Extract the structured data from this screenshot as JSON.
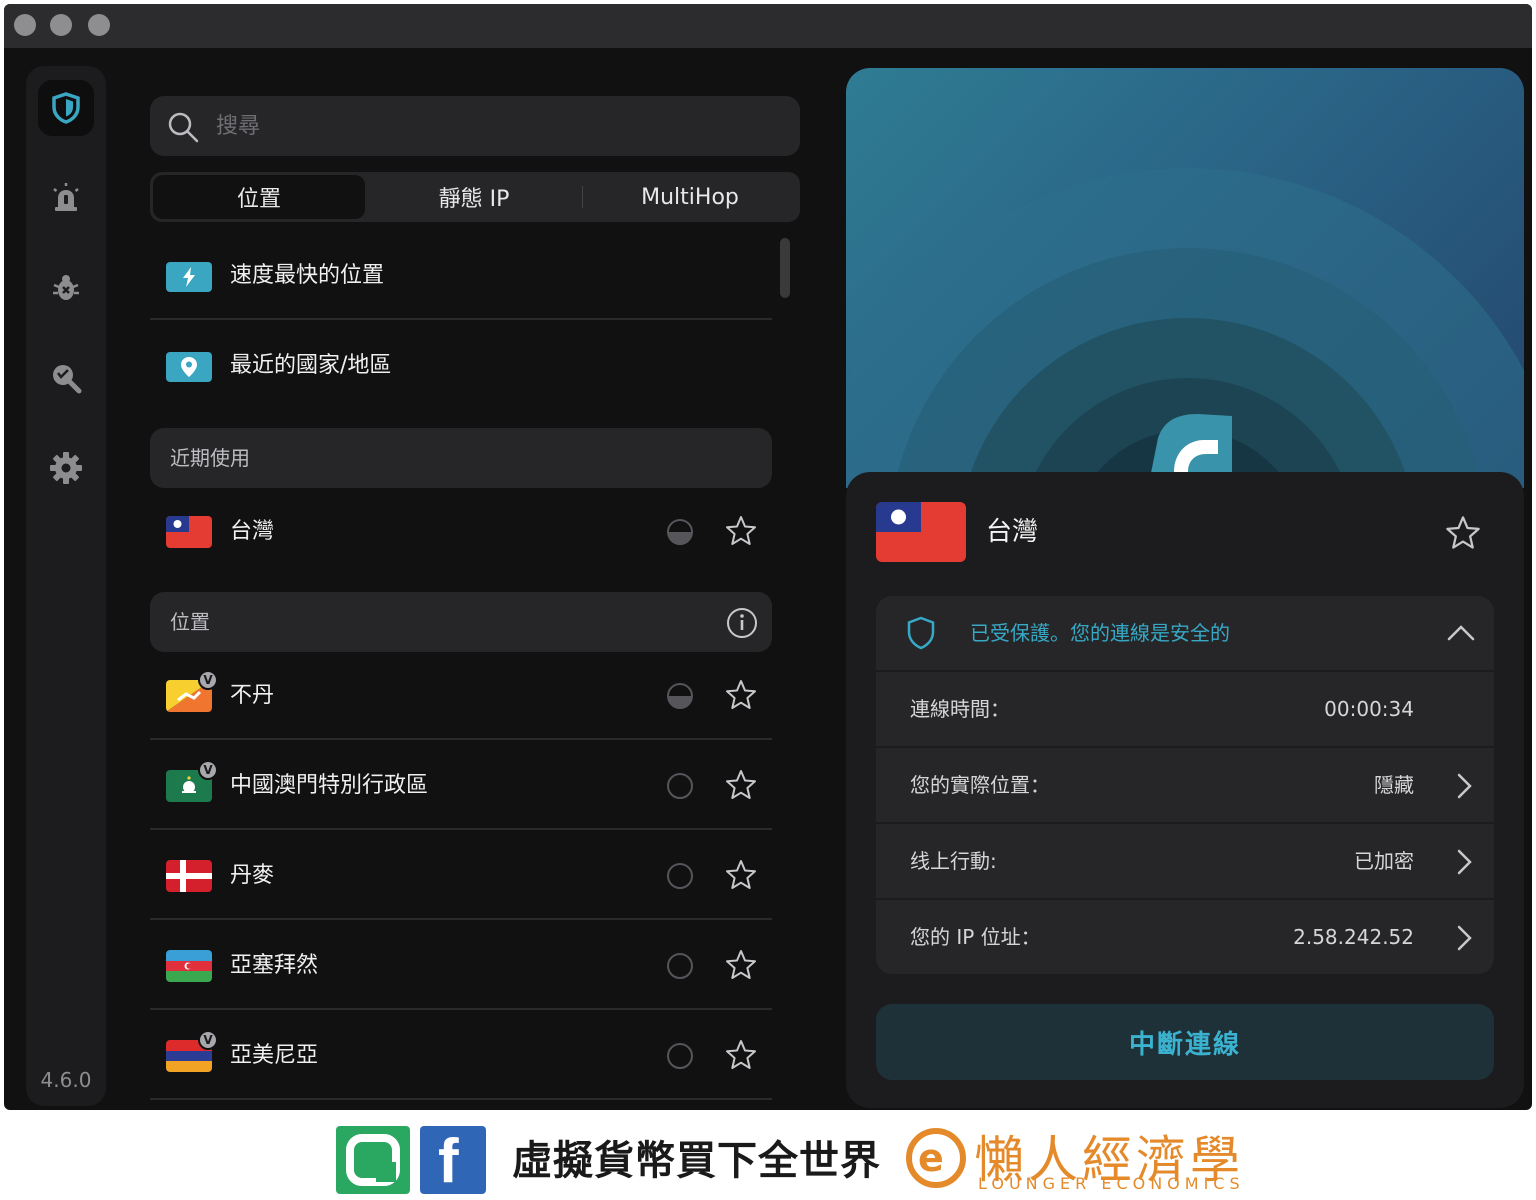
{
  "app": {
    "version": "4.6.0"
  },
  "search": {
    "placeholder": "搜尋"
  },
  "tabs": [
    {
      "label": "位置",
      "active": true
    },
    {
      "label": "靜態 IP",
      "active": false
    },
    {
      "label": "MultiHop",
      "active": false
    }
  ],
  "quick": [
    {
      "label": "速度最快的位置",
      "icon": "lightning-icon"
    },
    {
      "label": "最近的國家/地區",
      "icon": "location-pin-icon"
    }
  ],
  "sections": {
    "recent": "近期使用",
    "locations": "位置"
  },
  "recent": [
    {
      "label": "台灣",
      "flag": "tw",
      "load": "half"
    }
  ],
  "locations": [
    {
      "label": "不丹",
      "flag": "bt",
      "virtual": true,
      "load": "half"
    },
    {
      "label": "中國澳門特別行政區",
      "flag": "mo",
      "virtual": true,
      "load": "low"
    },
    {
      "label": "丹麥",
      "flag": "dk",
      "virtual": false,
      "load": "low"
    },
    {
      "label": "亞塞拜然",
      "flag": "az",
      "virtual": false,
      "load": "low"
    },
    {
      "label": "亞美尼亞",
      "flag": "am",
      "virtual": true,
      "load": "low"
    }
  ],
  "badge": {
    "virtual": "V"
  },
  "connection": {
    "country": "台灣",
    "status": "已受保護。您的連線是安全的",
    "rows": [
      {
        "label": "連線時間：",
        "value": "00:00:34",
        "chevron": false
      },
      {
        "label": "您的實際位置：",
        "value": "隱藏",
        "chevron": true
      },
      {
        "label": "线上行動:",
        "value": "已加密",
        "chevron": true
      },
      {
        "label": "您的 IP 位址：",
        "value": "2.58.242.52",
        "chevron": true
      }
    ],
    "disconnect_label": "中斷連線"
  },
  "banner": {
    "slogan": "虛擬貨幣買下全世界",
    "brand_name": "懶人經濟學",
    "brand_sub": "LOUNGER ECONOMICS",
    "brand_mark": "e"
  },
  "colors": {
    "accent": "#37a9c6",
    "background": "#111112",
    "panel": "#1c1c1e",
    "brand": "#e58a2a"
  }
}
